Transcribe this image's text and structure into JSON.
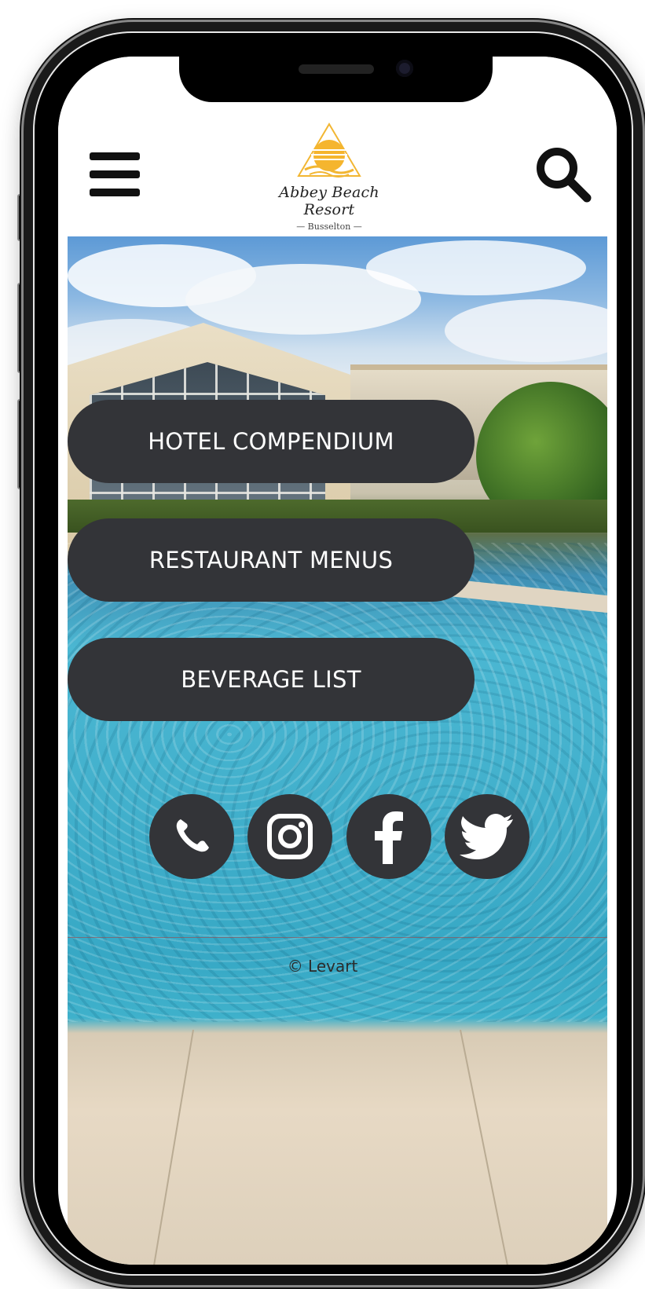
{
  "brand": {
    "name": "Abbey Beach Resort",
    "location": "— Busselton —"
  },
  "header": {
    "menu_icon": "hamburger-menu-icon",
    "search_icon": "search-icon"
  },
  "menu_buttons": [
    {
      "label": "HOTEL COMPENDIUM"
    },
    {
      "label": "RESTAURANT MENUS"
    },
    {
      "label": "BEVERAGE LIST"
    }
  ],
  "social": [
    {
      "icon": "phone-icon"
    },
    {
      "icon": "instagram-icon"
    },
    {
      "icon": "facebook-icon"
    },
    {
      "icon": "twitter-icon"
    }
  ],
  "footer": {
    "copyright": "© Levart"
  },
  "colors": {
    "button_bg": "#333438",
    "button_text": "#ffffff",
    "logo_gold": "#f2b632"
  }
}
